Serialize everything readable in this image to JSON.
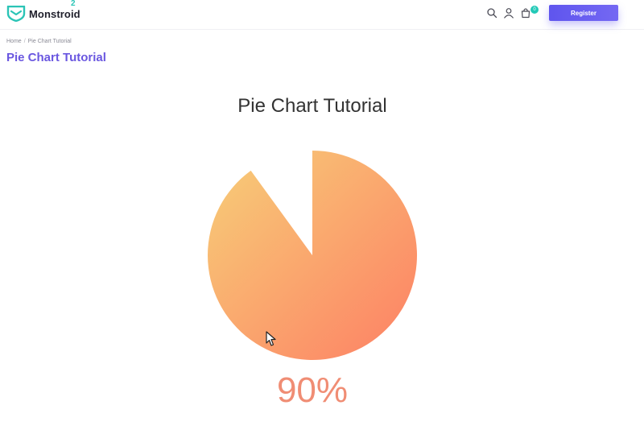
{
  "header": {
    "brand": "Monstroid",
    "brand_superscript": "2",
    "cart_count": "0",
    "register_label": "Register",
    "accent_color": "#6a57e0",
    "logo_color": "#2bc4b6",
    "icons": [
      "search-icon",
      "user-icon",
      "cart-icon"
    ]
  },
  "breadcrumb": {
    "home": "Home",
    "separator": "/",
    "current": "Pie Chart Tutorial"
  },
  "page_title": "Pie Chart Tutorial",
  "chart_data": {
    "type": "pie",
    "title": "Pie Chart Tutorial",
    "value_percent": 90,
    "display_value": "90%",
    "gradient": [
      "#f7cf78",
      "#fd7f64"
    ]
  }
}
